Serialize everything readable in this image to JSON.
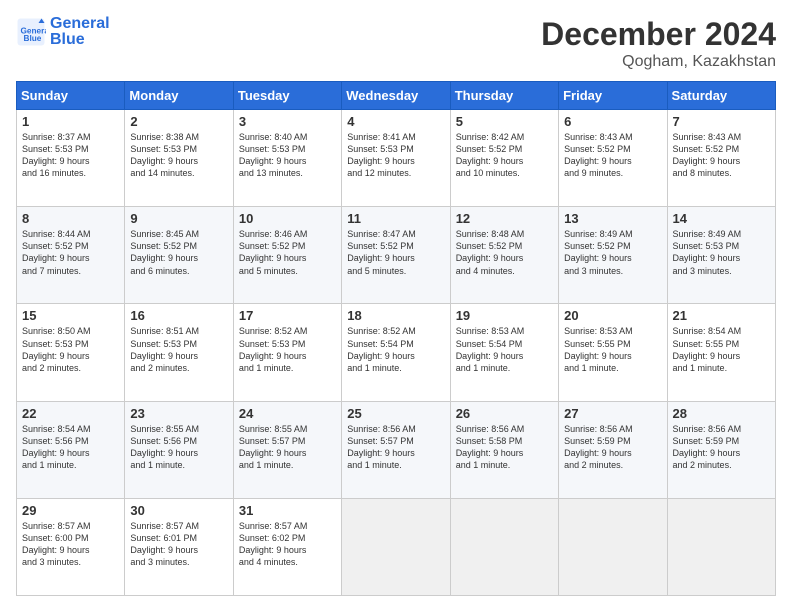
{
  "header": {
    "logo_line1": "General",
    "logo_line2": "Blue",
    "month": "December 2024",
    "location": "Qogham, Kazakhstan"
  },
  "days_of_week": [
    "Sunday",
    "Monday",
    "Tuesday",
    "Wednesday",
    "Thursday",
    "Friday",
    "Saturday"
  ],
  "weeks": [
    [
      {
        "day": 1,
        "lines": [
          "Sunrise: 8:37 AM",
          "Sunset: 5:53 PM",
          "Daylight: 9 hours",
          "and 16 minutes."
        ]
      },
      {
        "day": 2,
        "lines": [
          "Sunrise: 8:38 AM",
          "Sunset: 5:53 PM",
          "Daylight: 9 hours",
          "and 14 minutes."
        ]
      },
      {
        "day": 3,
        "lines": [
          "Sunrise: 8:40 AM",
          "Sunset: 5:53 PM",
          "Daylight: 9 hours",
          "and 13 minutes."
        ]
      },
      {
        "day": 4,
        "lines": [
          "Sunrise: 8:41 AM",
          "Sunset: 5:53 PM",
          "Daylight: 9 hours",
          "and 12 minutes."
        ]
      },
      {
        "day": 5,
        "lines": [
          "Sunrise: 8:42 AM",
          "Sunset: 5:52 PM",
          "Daylight: 9 hours",
          "and 10 minutes."
        ]
      },
      {
        "day": 6,
        "lines": [
          "Sunrise: 8:43 AM",
          "Sunset: 5:52 PM",
          "Daylight: 9 hours",
          "and 9 minutes."
        ]
      },
      {
        "day": 7,
        "lines": [
          "Sunrise: 8:43 AM",
          "Sunset: 5:52 PM",
          "Daylight: 9 hours",
          "and 8 minutes."
        ]
      }
    ],
    [
      {
        "day": 8,
        "lines": [
          "Sunrise: 8:44 AM",
          "Sunset: 5:52 PM",
          "Daylight: 9 hours",
          "and 7 minutes."
        ]
      },
      {
        "day": 9,
        "lines": [
          "Sunrise: 8:45 AM",
          "Sunset: 5:52 PM",
          "Daylight: 9 hours",
          "and 6 minutes."
        ]
      },
      {
        "day": 10,
        "lines": [
          "Sunrise: 8:46 AM",
          "Sunset: 5:52 PM",
          "Daylight: 9 hours",
          "and 5 minutes."
        ]
      },
      {
        "day": 11,
        "lines": [
          "Sunrise: 8:47 AM",
          "Sunset: 5:52 PM",
          "Daylight: 9 hours",
          "and 5 minutes."
        ]
      },
      {
        "day": 12,
        "lines": [
          "Sunrise: 8:48 AM",
          "Sunset: 5:52 PM",
          "Daylight: 9 hours",
          "and 4 minutes."
        ]
      },
      {
        "day": 13,
        "lines": [
          "Sunrise: 8:49 AM",
          "Sunset: 5:52 PM",
          "Daylight: 9 hours",
          "and 3 minutes."
        ]
      },
      {
        "day": 14,
        "lines": [
          "Sunrise: 8:49 AM",
          "Sunset: 5:53 PM",
          "Daylight: 9 hours",
          "and 3 minutes."
        ]
      }
    ],
    [
      {
        "day": 15,
        "lines": [
          "Sunrise: 8:50 AM",
          "Sunset: 5:53 PM",
          "Daylight: 9 hours",
          "and 2 minutes."
        ]
      },
      {
        "day": 16,
        "lines": [
          "Sunrise: 8:51 AM",
          "Sunset: 5:53 PM",
          "Daylight: 9 hours",
          "and 2 minutes."
        ]
      },
      {
        "day": 17,
        "lines": [
          "Sunrise: 8:52 AM",
          "Sunset: 5:53 PM",
          "Daylight: 9 hours",
          "and 1 minute."
        ]
      },
      {
        "day": 18,
        "lines": [
          "Sunrise: 8:52 AM",
          "Sunset: 5:54 PM",
          "Daylight: 9 hours",
          "and 1 minute."
        ]
      },
      {
        "day": 19,
        "lines": [
          "Sunrise: 8:53 AM",
          "Sunset: 5:54 PM",
          "Daylight: 9 hours",
          "and 1 minute."
        ]
      },
      {
        "day": 20,
        "lines": [
          "Sunrise: 8:53 AM",
          "Sunset: 5:55 PM",
          "Daylight: 9 hours",
          "and 1 minute."
        ]
      },
      {
        "day": 21,
        "lines": [
          "Sunrise: 8:54 AM",
          "Sunset: 5:55 PM",
          "Daylight: 9 hours",
          "and 1 minute."
        ]
      }
    ],
    [
      {
        "day": 22,
        "lines": [
          "Sunrise: 8:54 AM",
          "Sunset: 5:56 PM",
          "Daylight: 9 hours",
          "and 1 minute."
        ]
      },
      {
        "day": 23,
        "lines": [
          "Sunrise: 8:55 AM",
          "Sunset: 5:56 PM",
          "Daylight: 9 hours",
          "and 1 minute."
        ]
      },
      {
        "day": 24,
        "lines": [
          "Sunrise: 8:55 AM",
          "Sunset: 5:57 PM",
          "Daylight: 9 hours",
          "and 1 minute."
        ]
      },
      {
        "day": 25,
        "lines": [
          "Sunrise: 8:56 AM",
          "Sunset: 5:57 PM",
          "Daylight: 9 hours",
          "and 1 minute."
        ]
      },
      {
        "day": 26,
        "lines": [
          "Sunrise: 8:56 AM",
          "Sunset: 5:58 PM",
          "Daylight: 9 hours",
          "and 1 minute."
        ]
      },
      {
        "day": 27,
        "lines": [
          "Sunrise: 8:56 AM",
          "Sunset: 5:59 PM",
          "Daylight: 9 hours",
          "and 2 minutes."
        ]
      },
      {
        "day": 28,
        "lines": [
          "Sunrise: 8:56 AM",
          "Sunset: 5:59 PM",
          "Daylight: 9 hours",
          "and 2 minutes."
        ]
      }
    ],
    [
      {
        "day": 29,
        "lines": [
          "Sunrise: 8:57 AM",
          "Sunset: 6:00 PM",
          "Daylight: 9 hours",
          "and 3 minutes."
        ]
      },
      {
        "day": 30,
        "lines": [
          "Sunrise: 8:57 AM",
          "Sunset: 6:01 PM",
          "Daylight: 9 hours",
          "and 3 minutes."
        ]
      },
      {
        "day": 31,
        "lines": [
          "Sunrise: 8:57 AM",
          "Sunset: 6:02 PM",
          "Daylight: 9 hours",
          "and 4 minutes."
        ]
      },
      null,
      null,
      null,
      null
    ]
  ]
}
